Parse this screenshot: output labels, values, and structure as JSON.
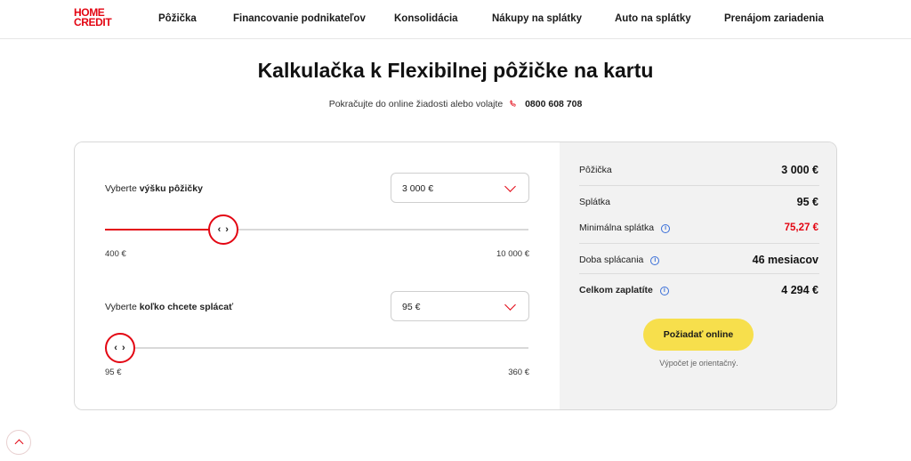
{
  "header": {
    "logo_line1": "HOME",
    "logo_line2": "CREDIT",
    "nav": [
      "Pôžička",
      "Financovanie podnikateľov",
      "Konsolidácia",
      "Nákupy na splátky",
      "Auto na splátky",
      "Prenájom zariadenia"
    ]
  },
  "page": {
    "title": "Kalkulačka k Flexibilnej pôžičke na kartu",
    "subtitle_text": "Pokračujte do online žiadosti alebo volajte",
    "phone": "0800 608 708"
  },
  "calculator": {
    "amount": {
      "label_prefix": "Vyberte ",
      "label_bold": "výšku pôžičky",
      "selected": "3 000 €",
      "min_label": "400 €",
      "max_label": "10 000 €",
      "slider_fraction": 0.28
    },
    "payment": {
      "label_prefix": "Vyberte ",
      "label_bold": "koľko chcete splácať",
      "selected": "95 €",
      "min_label": "95 €",
      "max_label": "360 €",
      "slider_fraction": 0.0
    },
    "thumb_glyph": "‹ ›"
  },
  "summary": {
    "rows": [
      {
        "label": "Pôžička",
        "value": "3 000 €"
      },
      {
        "label": "Splátka",
        "value": "95 €"
      },
      {
        "label": "Minimálna splátka",
        "value": "75,27 €"
      },
      {
        "label": "Doba splácania",
        "value": "46 mesiacov"
      },
      {
        "label": "Celkom zaplatíte",
        "value": "4 294 €"
      }
    ],
    "info_glyph": "i",
    "cta": "Požiadať online",
    "note": "Výpočet je orientačný."
  },
  "colors": {
    "brand_red": "#e30613",
    "cta_yellow": "#f7df4c",
    "info_blue": "#3a6fd8"
  }
}
